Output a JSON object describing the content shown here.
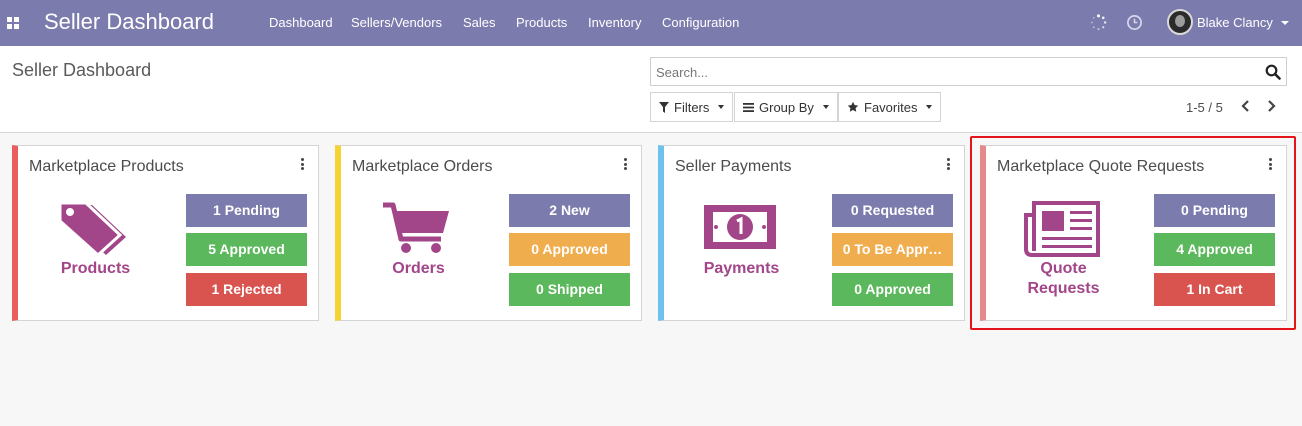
{
  "navbar": {
    "app_title": "Seller Dashboard",
    "menu": [
      "Dashboard",
      "Sellers/Vendors",
      "Sales",
      "Products",
      "Inventory",
      "Configuration"
    ],
    "user_name": "Blake Clancy",
    "icons": [
      "apps-icon",
      "activity-spinner-icon",
      "clock-icon",
      "avatar",
      "caret-down-icon"
    ]
  },
  "control_panel": {
    "title": "Seller Dashboard",
    "search_placeholder": "Search...",
    "filters_label": "Filters",
    "groupby_label": "Group By",
    "favorites_label": "Favorites",
    "pager": "1-5 / 5"
  },
  "colors": {
    "navbar": "#7c7bad",
    "brand_purple": "#a24689",
    "purple_stat": "#7c7bad",
    "green": "#5cb85c",
    "orange": "#f0ad4e",
    "red": "#d9534f",
    "card_border_red": "#ea5d5d",
    "card_border_yellow": "#f5d432",
    "card_border_blue": "#6cc1ed",
    "card_border_pink": "#e58a8a",
    "highlight": "#e5131a"
  },
  "cards": [
    {
      "title": "Marketplace Products",
      "label": "Products",
      "icon": "tag-icon",
      "stats": [
        {
          "text": "1 Pending",
          "color": "purple"
        },
        {
          "text": "5 Approved",
          "color": "green"
        },
        {
          "text": "1 Rejected",
          "color": "red"
        }
      ]
    },
    {
      "title": "Marketplace Orders",
      "label": "Orders",
      "icon": "cart-icon",
      "stats": [
        {
          "text": "2 New",
          "color": "purple"
        },
        {
          "text": "0 Approved",
          "color": "orange"
        },
        {
          "text": "0 Shipped",
          "color": "green"
        }
      ]
    },
    {
      "title": "Seller Payments",
      "label": "Payments",
      "icon": "money-icon",
      "stats": [
        {
          "text": "0 Requested",
          "color": "purple"
        },
        {
          "text": "0 To Be Appr…",
          "color": "orange"
        },
        {
          "text": "0 Approved",
          "color": "green"
        }
      ]
    },
    {
      "title": "Marketplace Quote Requests",
      "label": "Quote Requests",
      "label_lines": [
        "Quote",
        "Requests"
      ],
      "icon": "newspaper-icon",
      "stats": [
        {
          "text": "0 Pending",
          "color": "purple"
        },
        {
          "text": "4 Approved",
          "color": "green"
        },
        {
          "text": "1 In Cart",
          "color": "red"
        }
      ]
    }
  ]
}
